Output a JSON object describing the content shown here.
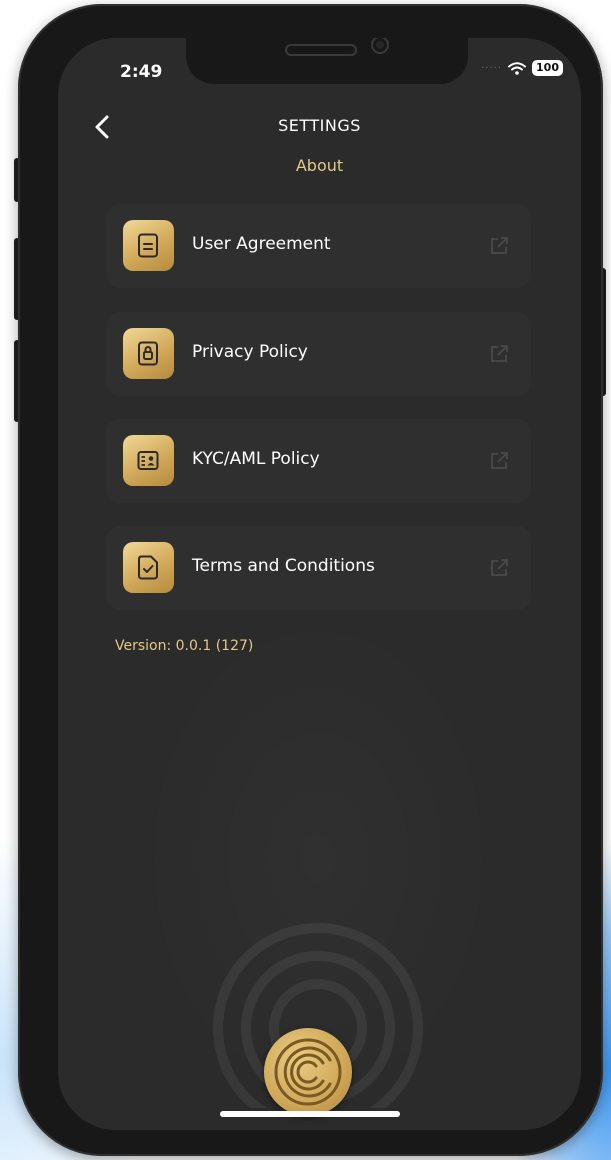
{
  "status_bar": {
    "time": "2:49",
    "battery": "100"
  },
  "header": {
    "title": "SETTINGS",
    "subtitle": "About"
  },
  "menu": {
    "items": [
      {
        "label": "User Agreement",
        "icon": "document-icon"
      },
      {
        "label": "Privacy Policy",
        "icon": "lock-document-icon"
      },
      {
        "label": "KYC/AML Policy",
        "icon": "id-card-icon"
      },
      {
        "label": "Terms and Conditions",
        "icon": "checked-document-icon"
      }
    ],
    "trailing_icon": "external-link-icon"
  },
  "footer": {
    "version": "Version: 0.0.1 (127)"
  },
  "colors": {
    "accent_gold": "#e3c887",
    "icon_gold": "#d2aa5b",
    "screen_background": "#2b2b2b",
    "row_background": "#2f2f2f"
  }
}
